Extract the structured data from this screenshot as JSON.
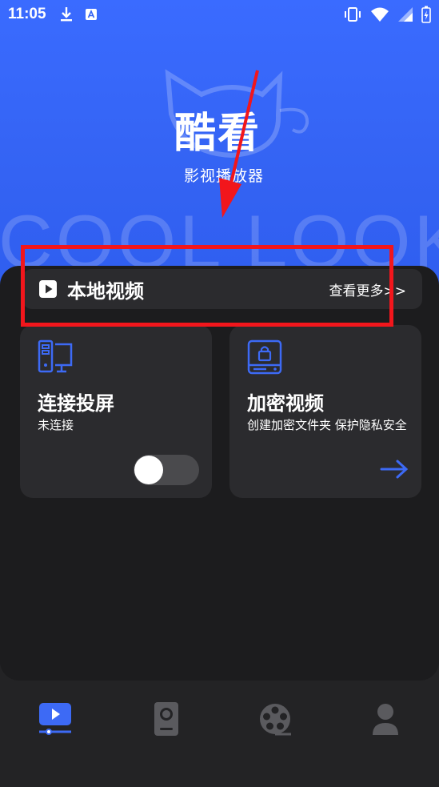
{
  "status_bar": {
    "time": "11:05",
    "icons": [
      "download-icon",
      "notification-a-icon",
      "vibrate-icon",
      "wifi-icon",
      "signal-icon",
      "battery-charging-icon"
    ]
  },
  "hero": {
    "logo_text": "酷看",
    "subtitle": "影视播放器",
    "watermark": "COOL LOOK",
    "colors": {
      "primary": "#3463f3"
    }
  },
  "local_video": {
    "icon": "play-square-icon",
    "title": "本地视频",
    "more_label": "查看更多>>"
  },
  "cards": {
    "cast": {
      "icon": "pc-device-icon",
      "title": "连接投屏",
      "subtitle": "未连接",
      "toggle_on": false
    },
    "encrypted": {
      "icon": "lock-drive-icon",
      "title": "加密视频",
      "subtitle": "创建加密文件夹 保护隐私安全",
      "action_icon": "arrow-right-icon"
    }
  },
  "bottom_nav": {
    "items": [
      {
        "icon": "video-play-icon",
        "active": true
      },
      {
        "icon": "speaker-device-icon",
        "active": false
      },
      {
        "icon": "film-reel-icon",
        "active": false
      },
      {
        "icon": "user-icon",
        "active": false
      }
    ],
    "colors": {
      "active": "#3d6af5",
      "inactive": "#5a5a5e"
    }
  },
  "annotation": {
    "color": "#f2161c"
  }
}
